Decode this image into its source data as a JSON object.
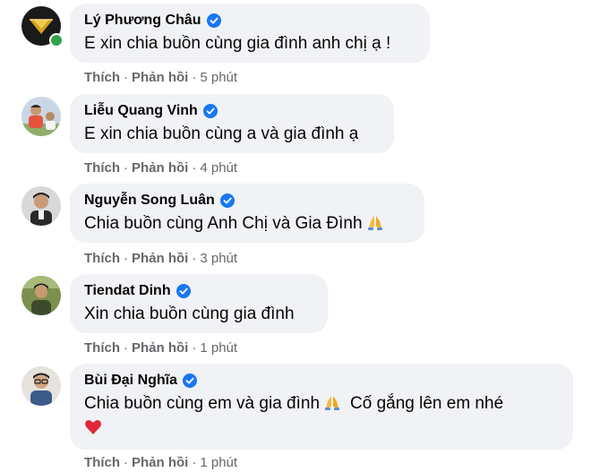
{
  "comments": [
    {
      "author": "Lý Phương Châu",
      "text": "E xin chia buồn cùng gia đình anh chị ạ !",
      "like_label": "Thích",
      "reply_label": "Phản hồi",
      "time": "5 phút",
      "online": true,
      "avatar_icon": "gold-diamond-logo-icon"
    },
    {
      "author": "Liễu Quang Vinh",
      "text": "E xin chia buồn cùng a và gia đình ạ",
      "like_label": "Thích",
      "reply_label": "Phản hồi",
      "time": "4 phút",
      "online": false,
      "avatar_icon": "football-player-photo-icon"
    },
    {
      "author": "Nguyễn Song Luân",
      "text": "Chia buồn cùng Anh Chị và Gia Đình",
      "text_emoji": "folded-hands-emoji",
      "like_label": "Thích",
      "reply_label": "Phản hồi",
      "time": "3 phút",
      "online": false,
      "avatar_icon": "man-portrait-photo-icon"
    },
    {
      "author": "Tiendat Dinh",
      "text": "Xin chia buồn cùng gia đình",
      "like_label": "Thích",
      "reply_label": "Phản hồi",
      "time": "1 phút",
      "online": false,
      "avatar_icon": "outdoor-portrait-photo-icon"
    },
    {
      "author": "Bùi Đại Nghĩa",
      "text": "Chia buồn cùng em và gia đình",
      "text_emoji": "folded-hands-emoji",
      "text_after": "Cố gắng lên em nhé",
      "line2_emoji": "red-heart-emoji",
      "like_label": "Thích",
      "reply_label": "Phản hồi",
      "time": "1 phút",
      "online": false,
      "avatar_icon": "man-glasses-portrait-icon"
    }
  ],
  "colors": {
    "bubble": "#f0f2f5",
    "text": "#050505",
    "meta": "#65676b",
    "verified": "#1877f2",
    "online": "#31a24c"
  }
}
